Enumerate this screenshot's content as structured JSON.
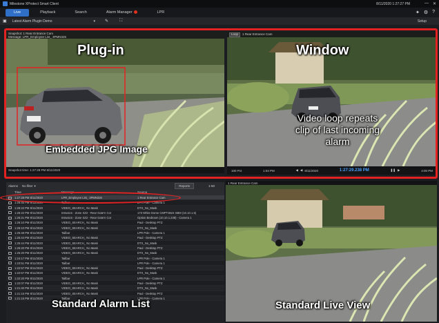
{
  "window": {
    "title": "Milestone XProtect Smart Client",
    "clock": "8/11/2020 1:27:27 PM",
    "controls": [
      "—",
      "✕"
    ]
  },
  "tabs": [
    {
      "label": "Live",
      "active": true
    },
    {
      "label": "Playback",
      "active": false
    },
    {
      "label": "Search",
      "active": false
    },
    {
      "label": "Alarm Manager",
      "active": false,
      "alarm": true
    },
    {
      "label": "LPR",
      "active": false
    }
  ],
  "toolbar": {
    "view_name": "Latest Alarm Plugin Demo",
    "setup_label": "Setup"
  },
  "panes": {
    "plugin": {
      "header_line1": "Snapshot: 1 Rear Entrance Cam",
      "header_line2": "Message: LPR_Employee List_ 3PMN326",
      "overlay_title": "Plug-in",
      "overlay_caption": "Embedded JPG Image",
      "footer": "Snapshot time: 1:27:28 PM 8/11/2020"
    },
    "window": {
      "header_badge": "Loop",
      "header_text": "1 Rear Entrance Cam",
      "overlay_title": "Window",
      "overlay_caption_1": "Video loop repeats",
      "overlay_caption_2": "clip of last incoming",
      "overlay_caption_3": "alarm",
      "playback": {
        "left": "100 Pct",
        "mid_left": "1:04 PM",
        "date": "8/11/2020",
        "time": "1:27:29.238 PM",
        "right": "4:00 PM"
      }
    },
    "live": {
      "header_text": "1 Rear Entrance Cam",
      "overlay_caption": "Standard Live View"
    }
  },
  "alarm_list": {
    "filter_label": "Alarms",
    "filter_value": "No filter",
    "reports_label": "Reports",
    "count": "1-50",
    "columns": {
      "time": "Time",
      "message": "Message",
      "source": "Source"
    },
    "overlay_caption": "Standard Alarm List",
    "rows": [
      {
        "time": "1:27:28 PM 8/11/2020",
        "message": "LPR_Employee List_ 3PMN326",
        "source": "1 Rear Entrance Cam",
        "selected": true
      },
      {
        "time": "1:26:45 PM 8/11/2020",
        "message": "Tailbar",
        "source": "LPR Pole - Camera 1"
      },
      {
        "time": "1:26:22 PM 8/11/2020",
        "message": "VIDEO_SEARCH_ No Mask",
        "source": "DTX_No_Mask"
      },
      {
        "time": "1:26:22 PM 8/11/2020",
        "message": "Intrusion - Zone XZ2 - Rear Gate'n Cor",
        "source": "173 White Dome CMPT3624 SBM (10.10.1.5)"
      },
      {
        "time": "1:26:21 PM 8/11/2020",
        "message": "Intrusion - Zone XZ2 - Rear Gate'n Cor",
        "source": "Option Bedroom (10.10.1.238) - Camera 1"
      },
      {
        "time": "1:26:10 PM 8/11/2020",
        "message": "VIDEO_SEARCH_ No Mask",
        "source": "Paul - Desktop PTZ"
      },
      {
        "time": "1:26:10 PM 8/11/2020",
        "message": "VIDEO_SEARCH_ No Mask",
        "source": "DTX_No_Mask"
      },
      {
        "time": "1:25:48 PM 8/11/2020",
        "message": "Tailbar",
        "source": "LPR Pole - Camera 1"
      },
      {
        "time": "1:25:44 PM 8/11/2020",
        "message": "VIDEO_SEARCH_ No Mask",
        "source": "Paul - Desktop PTZ"
      },
      {
        "time": "1:25:44 PM 8/11/2020",
        "message": "VIDEO_SEARCH_ No Mask",
        "source": "DTX_No_Mask"
      },
      {
        "time": "1:25:20 PM 8/11/2020",
        "message": "VIDEO_SEARCH_ No Mask",
        "source": "Paul - Desktop PTZ"
      },
      {
        "time": "1:25:20 PM 8/11/2020",
        "message": "VIDEO_SEARCH_ No Mask",
        "source": "DTX_No_Mask"
      },
      {
        "time": "1:24:17 PM 8/11/2020",
        "message": "Tailbar",
        "source": "LPR Pole - Camera 1"
      },
      {
        "time": "1:23:51 PM 8/11/2020",
        "message": "Tailbar",
        "source": "LPR Pole - Camera 1"
      },
      {
        "time": "1:22:57 PM 8/11/2020",
        "message": "VIDEO_SEARCH_ No Mask",
        "source": "Paul - Desktop PTZ"
      },
      {
        "time": "1:22:57 PM 8/11/2020",
        "message": "VIDEO_SEARCH_ No Mask",
        "source": "DTX_No_Mask"
      },
      {
        "time": "1:22:20 PM 8/11/2020",
        "message": "Tailbar",
        "source": "LPR Pole - Camera 1"
      },
      {
        "time": "1:22:07 PM 8/11/2020",
        "message": "VIDEO_SEARCH_ No Mask",
        "source": "Paul - Desktop PTZ"
      },
      {
        "time": "1:21:40 PM 8/11/2020",
        "message": "VIDEO_SEARCH_ No Mask",
        "source": "DTX_No_Mask"
      },
      {
        "time": "1:21:15 PM 8/11/2020",
        "message": "VIDEO_SEARCH_ No Mask",
        "source": "Paul - Desktop PTZ"
      },
      {
        "time": "1:21:15 PM 8/11/2020",
        "message": "Tailbar",
        "source": "LPR Pole - Camera 1"
      }
    ]
  },
  "colors": {
    "accent_blue": "#2f6fc8",
    "highlight_red": "#e42222",
    "playback_time": "#4aa0ff"
  }
}
